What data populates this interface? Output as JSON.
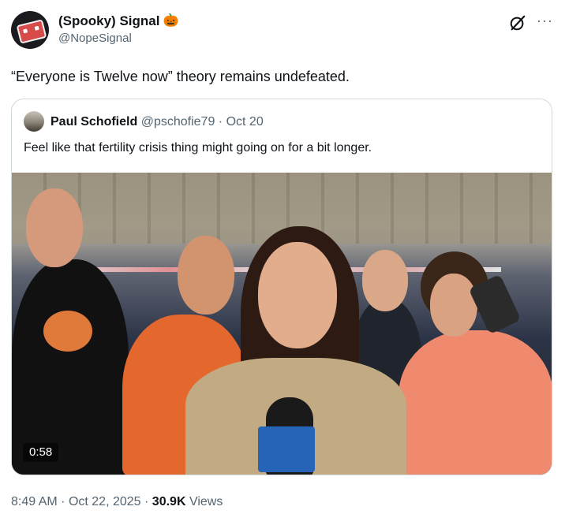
{
  "tweet": {
    "display_name": "(Spooky) Signal",
    "name_emoji": "🎃",
    "handle": "@NopeSignal",
    "text": "“Everyone is Twelve now” theory remains undefeated.",
    "more_icon": "more-horizontal-icon",
    "grok_icon": "grok-icon"
  },
  "quote": {
    "author_name": "Paul Schofield",
    "author_handle": "@pschofie79",
    "separator": "·",
    "date": "Oct 20",
    "text": "Feel like that fertility crisis thing might going on for a bit longer.",
    "video_duration": "0:58"
  },
  "footer": {
    "time": "8:49 AM",
    "sep1": "·",
    "date": "Oct 22, 2025",
    "sep2": "·",
    "views_count": "30.9K",
    "views_label": "Views"
  },
  "colors": {
    "text_primary": "#0f1419",
    "text_secondary": "#536471",
    "border": "#cfd9de"
  }
}
